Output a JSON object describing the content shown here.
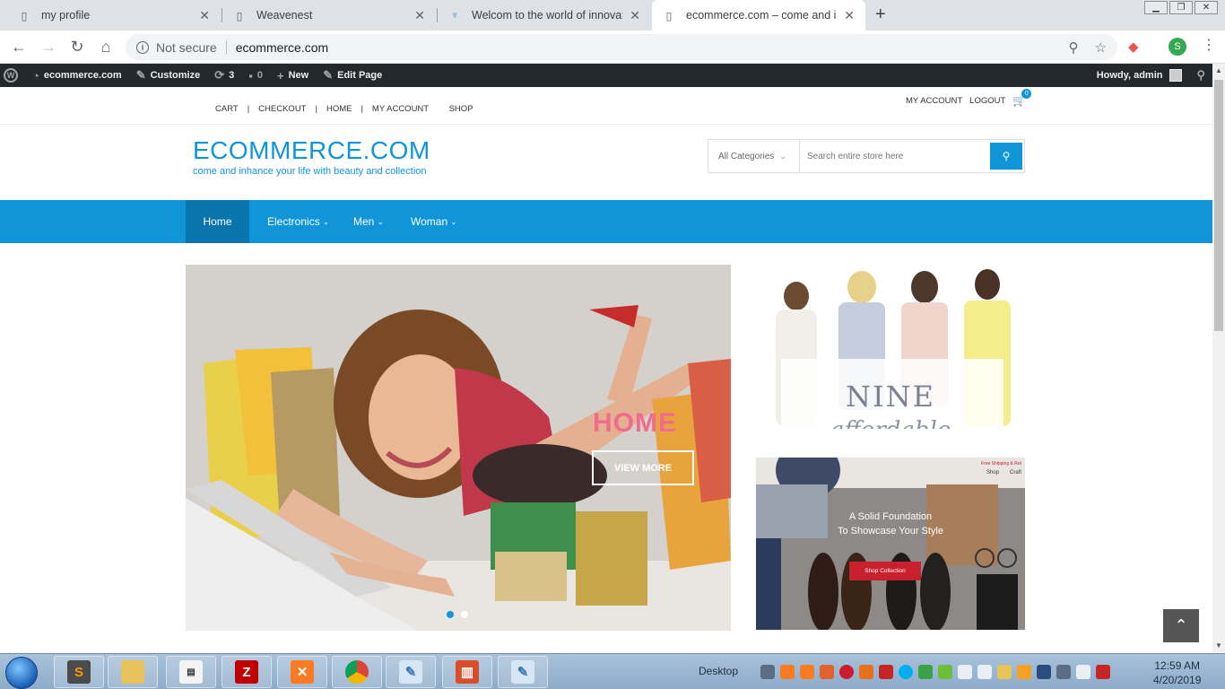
{
  "browser": {
    "tabs": [
      {
        "title": "my profile",
        "active": false
      },
      {
        "title": "Weavenest",
        "active": false
      },
      {
        "title": "Welcom to the world of innovatio",
        "active": false
      },
      {
        "title": "ecommerce.com – come and inh",
        "active": true
      }
    ],
    "security_label": "Not secure",
    "url": "ecommerce.com"
  },
  "adminbar": {
    "site": "ecommerce.com",
    "customize": "Customize",
    "updates": "3",
    "comments": "0",
    "new": "New",
    "edit": "Edit Page",
    "howdy": "Howdy, admin"
  },
  "site": {
    "toplinks": [
      "CART",
      "CHECKOUT",
      "HOME",
      "MY ACCOUNT",
      "SHOP"
    ],
    "account": "MY ACCOUNT",
    "logout": "LOGOUT",
    "cart_count": "0",
    "logo": "ECOMMERCE.COM",
    "tagline": "come and inhance your life with beauty and collection",
    "search": {
      "category": "All Categories",
      "placeholder": "Search entire store here"
    },
    "nav": [
      {
        "label": "Home"
      },
      {
        "label": "Electronics"
      },
      {
        "label": "Men"
      },
      {
        "label": "Woman"
      }
    ],
    "slider": {
      "title": "HOME",
      "button": "VIEW MORE"
    },
    "banner1": {
      "title": "NINE",
      "subtitle": "affordable"
    },
    "banner2": {
      "line1": "A Solid Foundation",
      "line2": "To Showcase Your Style",
      "button": "Shop Collection",
      "nav1": "Shop",
      "nav2": "Craft",
      "tag": "Free Shipping & Ret"
    }
  },
  "taskbar": {
    "desktop": "Desktop",
    "time": "12:59 AM",
    "date": "4/20/2019"
  },
  "colors": {
    "brand": "#0f95d8",
    "admin_bar": "#23282d",
    "slide_title": "#f06c8e",
    "cta_red": "#c8202d"
  }
}
